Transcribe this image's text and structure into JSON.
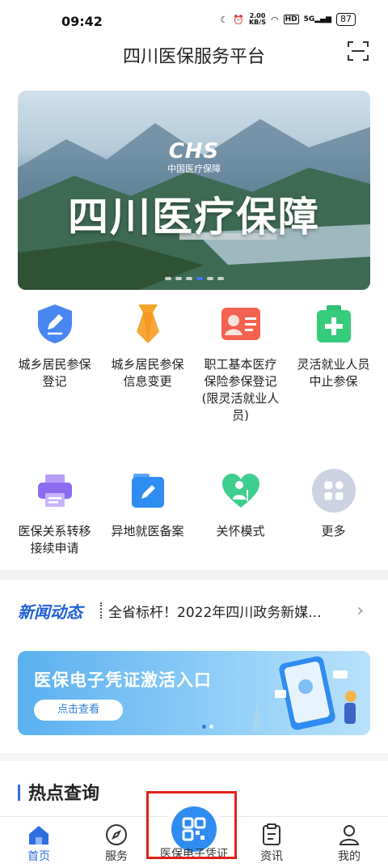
{
  "status": {
    "time": "09:42",
    "speed": "2.00",
    "speed_unit": "KB/S",
    "hd": "HD",
    "net": "5G",
    "battery": "87"
  },
  "header": {
    "title": "四川医保服务平台"
  },
  "banner": {
    "logo": "CHS",
    "logo_sub": "中国医疗保障",
    "headline": "四川医疗保障"
  },
  "services_row1": [
    {
      "label": "城乡居民参保登记",
      "icon": "shield-pen-icon"
    },
    {
      "label": "城乡居民参保信息变更",
      "icon": "tie-icon"
    },
    {
      "label": "职工基本医疗保险参保登记(限灵活就业人员)",
      "icon": "id-card-icon"
    },
    {
      "label": "灵活就业人员中止参保",
      "icon": "medical-kit-icon"
    }
  ],
  "services_row2": [
    {
      "label": "医保关系转移接续申请",
      "icon": "printer-icon"
    },
    {
      "label": "异地就医备案",
      "icon": "folder-pen-icon"
    },
    {
      "label": "关怀模式",
      "icon": "heart-person-icon"
    },
    {
      "label": "更多",
      "icon": "more-grid-icon"
    }
  ],
  "news": {
    "tag": "新闻动态",
    "text": "全省标杆！2022年四川政务新媒..."
  },
  "promo": {
    "title": "医保电子凭证激活入口",
    "button": "点击查看"
  },
  "hot": {
    "title": "热点查询"
  },
  "tabs": {
    "home": "首页",
    "service": "服务",
    "center": "医保电子凭证",
    "news": "资讯",
    "mine": "我的"
  },
  "colors": {
    "accent": "#2f6fe0",
    "highlight": "#e0201c"
  }
}
